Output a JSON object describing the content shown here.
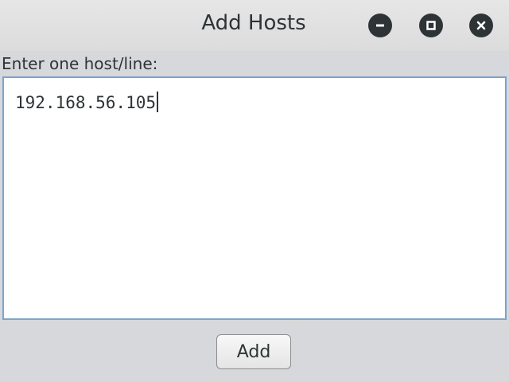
{
  "window": {
    "title": "Add Hosts",
    "controls": {
      "minimize_icon": "minimize-icon",
      "maximize_icon": "maximize-icon",
      "close_icon": "close-icon"
    }
  },
  "form": {
    "prompt": "Enter one host/line:",
    "hosts_text": "192.168.56.105",
    "add_label": "Add"
  },
  "colors": {
    "background": "#d6d8dc",
    "text": "#2e3436",
    "textarea_border": "#7fa3c9"
  }
}
